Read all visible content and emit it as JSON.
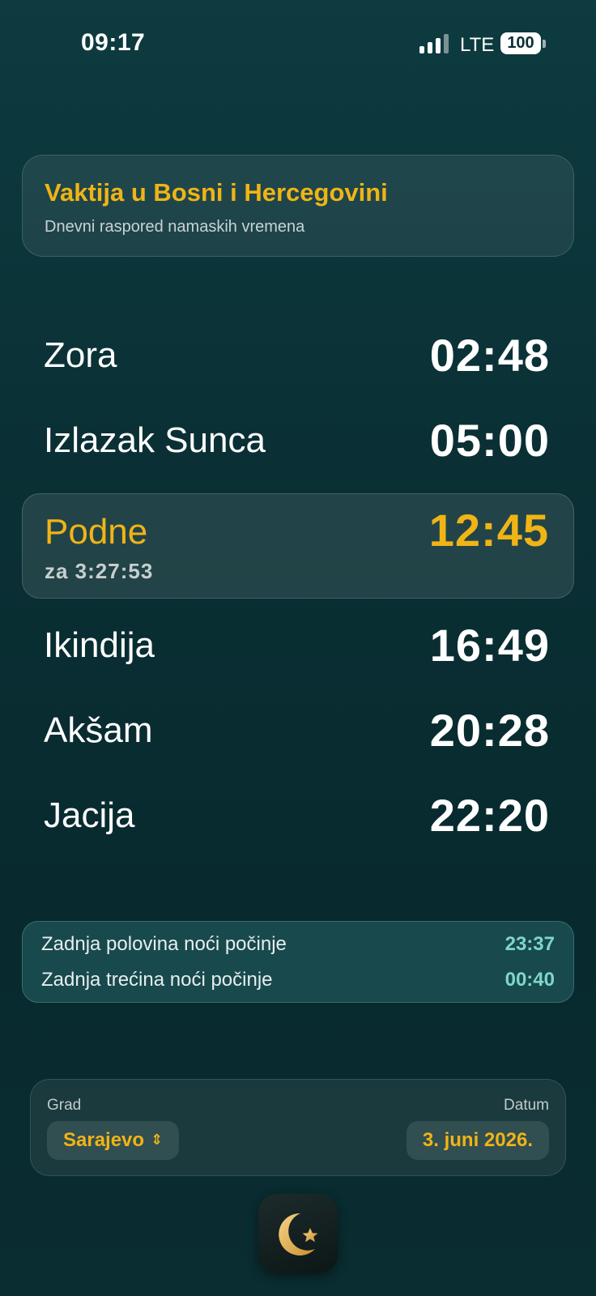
{
  "status_bar": {
    "time": "09:17",
    "network": "LTE",
    "battery": "100"
  },
  "header": {
    "title": "Vaktija u Bosni i Hercegovini",
    "subtitle": "Dnevni raspored namaskih vremena"
  },
  "prayers": [
    {
      "name": "Zora",
      "time": "02:48"
    },
    {
      "name": "Izlazak Sunca",
      "time": "05:00"
    },
    {
      "name": "Podne",
      "time": "12:45",
      "countdown": "za 3:27:53"
    },
    {
      "name": "Ikindija",
      "time": "16:49"
    },
    {
      "name": "Akšam",
      "time": "20:28"
    },
    {
      "name": "Jacija",
      "time": "22:20"
    }
  ],
  "night": [
    {
      "label": "Zadnja polovina noći počinje",
      "time": "23:37"
    },
    {
      "label": "Zadnja trećina noći počinje",
      "time": "00:40"
    }
  ],
  "controls": {
    "city_label": "Grad",
    "city_value": "Sarajevo",
    "date_label": "Datum",
    "date_value": "3. juni 2026."
  },
  "icons": {
    "city_chevron": "chevron-up-down-icon",
    "app_icon": "crescent-star-icon"
  },
  "colors": {
    "accent": "#f0b416",
    "night_accent": "#7fd6c8"
  }
}
